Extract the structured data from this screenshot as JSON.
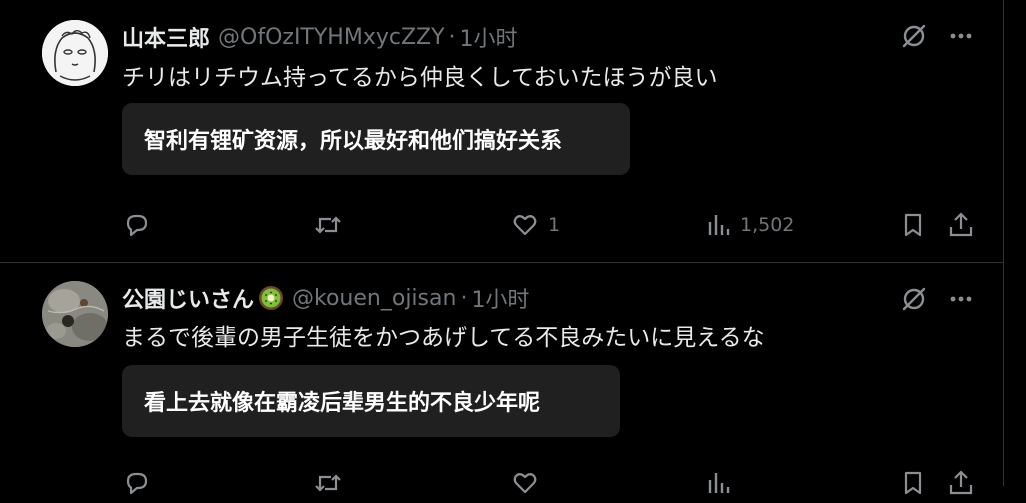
{
  "posts": [
    {
      "name": "山本三郎",
      "handle": "@OfOzITYHMxycZZY",
      "separator": "·",
      "time": "1小时",
      "text": "チリはリチウム持ってるから仲良くしておいたほうが良い",
      "translation": "智利有锂矿资源，所以最好和他们搞好关系",
      "actions": {
        "reply_count": "",
        "repost_count": "",
        "like_count": "1",
        "views_count": "1,502"
      },
      "icons": {
        "top": [
          "grok-icon",
          "more-icon"
        ],
        "actions": [
          "reply-icon",
          "repost-icon",
          "like-icon",
          "views-icon",
          "bookmark-icon",
          "share-icon"
        ]
      }
    },
    {
      "name": "公園じいさん",
      "handle": "@kouen_ojisan",
      "separator": "·",
      "time": "1小时",
      "text": "まるで後輩の男子生徒をかつあげしてる不良みたいに見えるな",
      "translation": "看上去就像在霸凌后辈男生的不良少年呢",
      "badge_icon": "kiwi-icon",
      "actions": {
        "reply_count": "",
        "repost_count": "",
        "like_count": "",
        "views_count": ""
      },
      "icons": {
        "top": [
          "grok-icon",
          "more-icon"
        ],
        "actions": [
          "reply-icon",
          "repost-icon",
          "like-icon",
          "views-icon",
          "bookmark-icon",
          "share-icon"
        ]
      }
    }
  ],
  "colors": {
    "background": "#000000",
    "text_primary": "#e7e9ea",
    "text_secondary": "#71767b",
    "translation_box": "#202020",
    "divider": "#2f3336"
  }
}
